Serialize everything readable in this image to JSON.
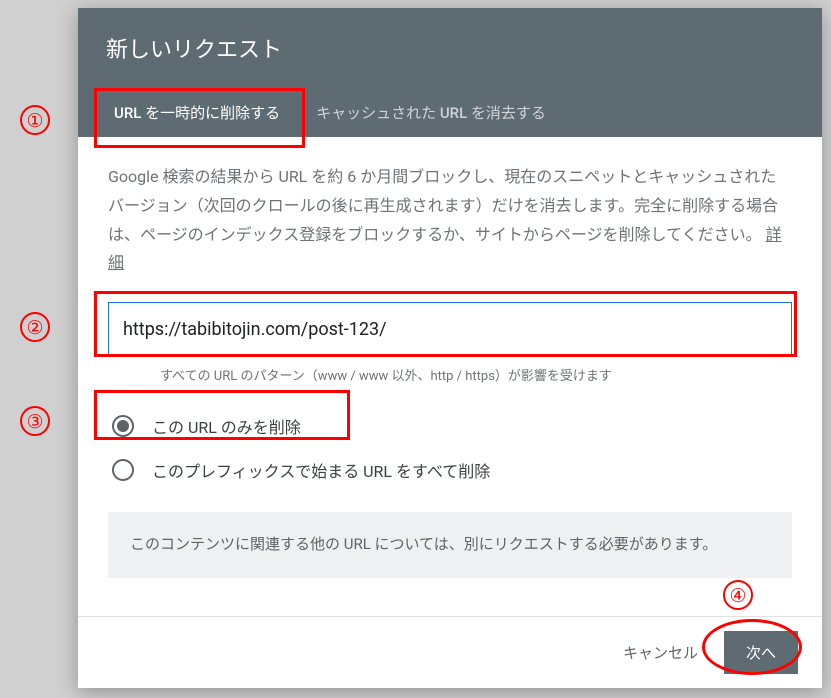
{
  "dialog": {
    "title": "新しいリクエスト"
  },
  "tabs": {
    "temp_remove": "URL を一時的に削除する",
    "clear_cache": "キャッシュされた URL を消去する"
  },
  "description": {
    "text": "Google 検索の結果から URL を約 6 か月間ブロックし、現在のスニペットとキャッシュされたバージョン（次回のクロールの後に再生成されます）だけを消去します。完全に削除する場合は、ページのインデックス登録をブロックするか、サイトからページを削除してください。",
    "link_text": "詳細"
  },
  "url_input": {
    "value": "https://tabibitojin.com/post-123/",
    "hint": "すべての URL のパターン（www / www 以外、http / https）が影響を受けます"
  },
  "radios": {
    "only_this": "この URL のみを削除",
    "prefix": "このプレフィックスで始まる URL をすべて削除"
  },
  "notice": "このコンテンツに関連する他の URL については、別にリクエストする必要があります。",
  "footer": {
    "cancel": "キャンセル",
    "next": "次へ"
  },
  "annotations": {
    "n1": "①",
    "n2": "②",
    "n3": "③",
    "n4": "④"
  }
}
